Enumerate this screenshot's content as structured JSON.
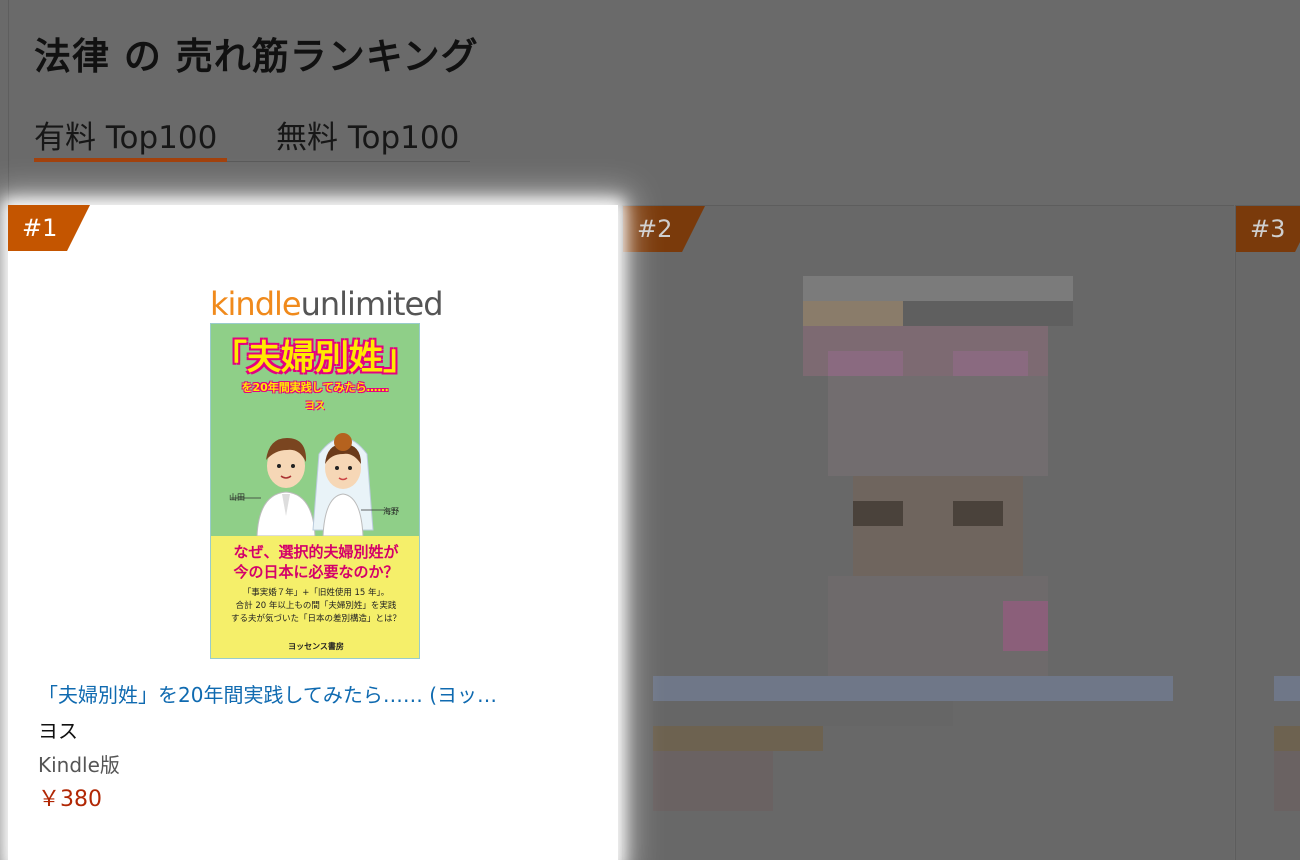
{
  "page": {
    "heading": "法律 の 売れ筋ランキング"
  },
  "tabs": [
    {
      "label": "有料 Top100",
      "active": true
    },
    {
      "label": "無料 Top100",
      "active": false
    }
  ],
  "colors": {
    "accent": "#c45500",
    "link": "#0f6ab0",
    "price": "#b12704",
    "overlay": "#6a6a6a"
  },
  "products": [
    {
      "rank": "#1",
      "cover": {
        "brand_kindle": "kindle",
        "brand_unlimited": "unlimited",
        "title": "「夫婦別姓」",
        "subtitle": "を20年間実践してみたら……",
        "author": "ヨス",
        "label_left": "山田",
        "label_right": "海野",
        "question_line1": "なぜ、選択的夫婦別姓が",
        "question_line2": "今の日本に必要なのか？",
        "desc_line1": "「事実婚７年」+「旧姓使用 15 年」。",
        "desc_line2": "合計 20 年以上もの間「夫婦別姓」を実践",
        "desc_line3": "する夫が気づいた「日本の差別構造」とは？",
        "publisher": "ヨッセンス書房"
      },
      "title": "「夫婦別姓」を20年間実践してみたら…… (ヨッ…",
      "author": "ヨス",
      "format": "Kindle版",
      "price": "￥380"
    },
    {
      "rank": "#2",
      "blurred": true
    },
    {
      "rank": "#3",
      "blurred": true
    }
  ]
}
